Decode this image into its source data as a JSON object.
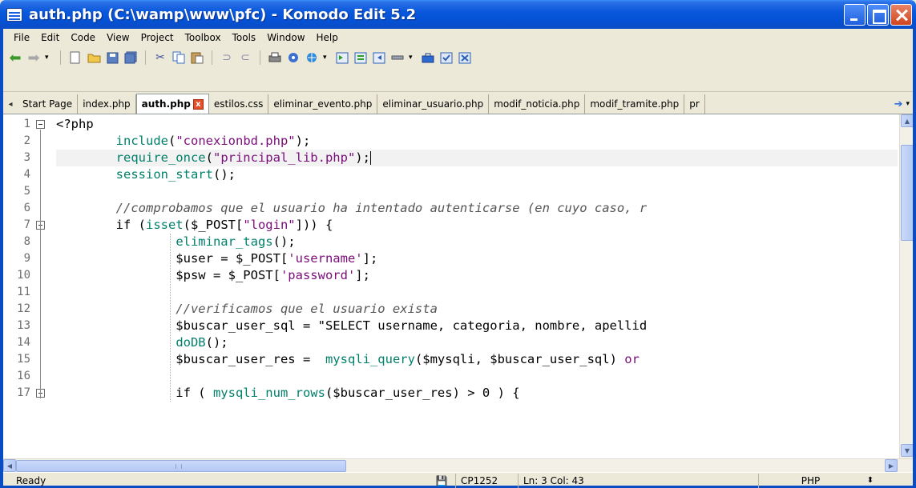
{
  "window": {
    "title": "auth.php (C:\\wamp\\www\\pfc) - Komodo Edit 5.2"
  },
  "menu": [
    "File",
    "Edit",
    "Code",
    "View",
    "Project",
    "Toolbox",
    "Tools",
    "Window",
    "Help"
  ],
  "toolbar_icons": [
    "back-icon",
    "forward-icon",
    "history-dropdown-icon",
    "new-file-icon",
    "open-folder-icon",
    "save-icon",
    "save-all-icon",
    "cut-icon",
    "copy-icon",
    "paste-icon",
    "undo-icon",
    "redo-icon",
    "print-icon",
    "preview-icon",
    "browser-icon",
    "macro-record-icon",
    "macro-play-icon",
    "macro-stop-icon",
    "line-icon",
    "toolbox-icon",
    "spell-icon",
    "sync-icon"
  ],
  "tabs": [
    {
      "label": "Start Page",
      "active": false
    },
    {
      "label": "index.php",
      "active": false
    },
    {
      "label": "auth.php",
      "active": true
    },
    {
      "label": "estilos.css",
      "active": false
    },
    {
      "label": "eliminar_evento.php",
      "active": false
    },
    {
      "label": "eliminar_usuario.php",
      "active": false
    },
    {
      "label": "modif_noticia.php",
      "active": false
    },
    {
      "label": "modif_tramite.php",
      "active": false
    },
    {
      "label": "pr",
      "active": false
    }
  ],
  "editor": {
    "current_line": 3,
    "lines": [
      {
        "n": "1",
        "text": "<?php"
      },
      {
        "n": "2",
        "text": "        include(\"conexionbd.php\");"
      },
      {
        "n": "3",
        "text": "        require_once(\"principal_lib.php\");"
      },
      {
        "n": "4",
        "text": "        session_start();"
      },
      {
        "n": "5",
        "text": ""
      },
      {
        "n": "6",
        "text": "        //comprobamos que el usuario ha intentado autenticarse (en cuyo caso, r"
      },
      {
        "n": "7",
        "text": "        if (isset($_POST[\"login\"])) {"
      },
      {
        "n": "8",
        "text": "                eliminar_tags();"
      },
      {
        "n": "9",
        "text": "                $user = $_POST['username'];"
      },
      {
        "n": "10",
        "text": "                $psw = $_POST['password'];"
      },
      {
        "n": "11",
        "text": ""
      },
      {
        "n": "12",
        "text": "                //verificamos que el usuario exista"
      },
      {
        "n": "13",
        "text": "                $buscar_user_sql = \"SELECT username, categoria, nombre, apellid"
      },
      {
        "n": "14",
        "text": "                doDB();"
      },
      {
        "n": "15",
        "text": "                $buscar_user_res =  mysqli_query($mysqli, $buscar_user_sql) or"
      },
      {
        "n": "16",
        "text": ""
      },
      {
        "n": "17",
        "text": "                if ( mysqli_num_rows($buscar_user_res) > 0 ) {"
      }
    ]
  },
  "status": {
    "text": "Ready",
    "encoding": "CP1252",
    "position": "Ln: 3 Col: 43",
    "language": "PHP"
  }
}
